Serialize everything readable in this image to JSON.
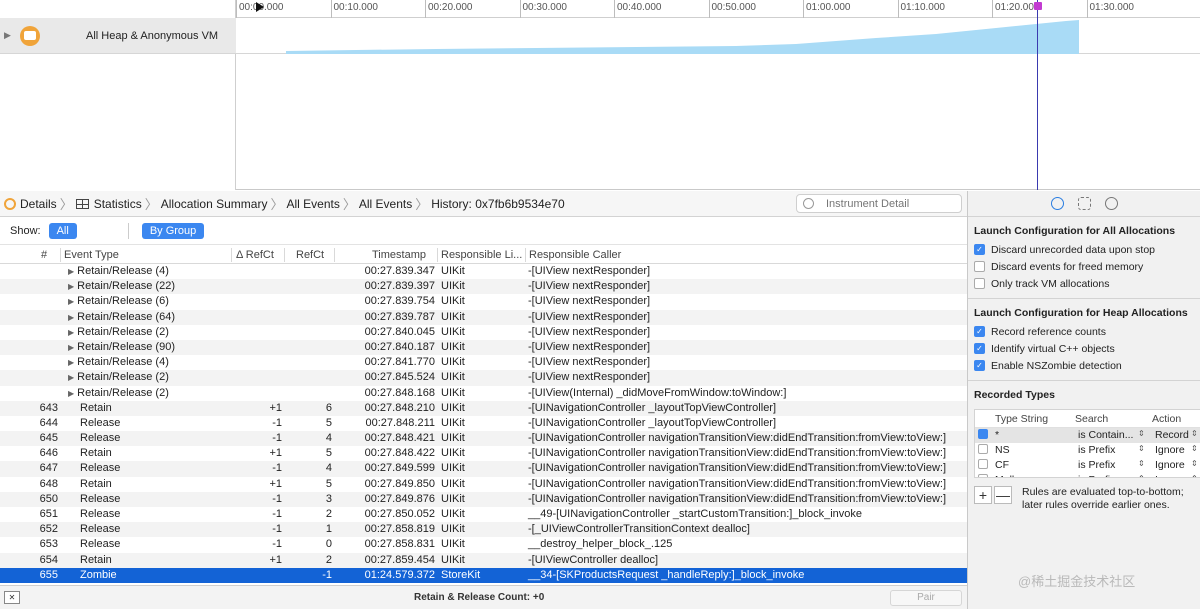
{
  "timeline": {
    "track_name": "All Heap & Anonymous VM",
    "ticks": [
      "00:00.000",
      "00:10.000",
      "00:20.000",
      "00:30.000",
      "00:40.000",
      "00:50.000",
      "01:00.000",
      "01:10.000",
      "01:20.000",
      "01:30.000"
    ]
  },
  "navbar": {
    "crumbs": [
      "Details",
      "Statistics",
      "Allocation Summary",
      "All Events",
      "All Events",
      "History: 0x7fb6b9534e70"
    ],
    "search_placeholder": "Instrument Detail"
  },
  "showbar": {
    "show_label": "Show:",
    "all_label": "All",
    "by_group_label": "By Group"
  },
  "table": {
    "columns": [
      "#",
      "Event Type",
      "Δ RefCt",
      "RefCt",
      "Timestamp",
      "Responsible Li...",
      "Responsible Caller"
    ],
    "rows": [
      {
        "num": "",
        "type": "Retain/Release (4)",
        "group": true,
        "delta": "",
        "refct": "",
        "ts": "00:27.839.347",
        "lib": "UIKit",
        "caller": "-[UIView nextResponder]"
      },
      {
        "num": "",
        "type": "Retain/Release (22)",
        "group": true,
        "delta": "",
        "refct": "",
        "ts": "00:27.839.397",
        "lib": "UIKit",
        "caller": "-[UIView nextResponder]"
      },
      {
        "num": "",
        "type": "Retain/Release (6)",
        "group": true,
        "delta": "",
        "refct": "",
        "ts": "00:27.839.754",
        "lib": "UIKit",
        "caller": "-[UIView nextResponder]"
      },
      {
        "num": "",
        "type": "Retain/Release (64)",
        "group": true,
        "delta": "",
        "refct": "",
        "ts": "00:27.839.787",
        "lib": "UIKit",
        "caller": "-[UIView nextResponder]"
      },
      {
        "num": "",
        "type": "Retain/Release (2)",
        "group": true,
        "delta": "",
        "refct": "",
        "ts": "00:27.840.045",
        "lib": "UIKit",
        "caller": "-[UIView nextResponder]"
      },
      {
        "num": "",
        "type": "Retain/Release (90)",
        "group": true,
        "delta": "",
        "refct": "",
        "ts": "00:27.840.187",
        "lib": "UIKit",
        "caller": "-[UIView nextResponder]"
      },
      {
        "num": "",
        "type": "Retain/Release (4)",
        "group": true,
        "delta": "",
        "refct": "",
        "ts": "00:27.841.770",
        "lib": "UIKit",
        "caller": "-[UIView nextResponder]"
      },
      {
        "num": "",
        "type": "Retain/Release (2)",
        "group": true,
        "delta": "",
        "refct": "",
        "ts": "00:27.845.524",
        "lib": "UIKit",
        "caller": "-[UIView nextResponder]"
      },
      {
        "num": "",
        "type": "Retain/Release (2)",
        "group": true,
        "delta": "",
        "refct": "",
        "ts": "00:27.848.168",
        "lib": "UIKit",
        "caller": "-[UIView(Internal) _didMoveFromWindow:toWindow:]"
      },
      {
        "num": "643",
        "type": "Retain",
        "group": false,
        "delta": "+1",
        "refct": "6",
        "ts": "00:27.848.210",
        "lib": "UIKit",
        "caller": "-[UINavigationController _layoutTopViewController]"
      },
      {
        "num": "644",
        "type": "Release",
        "group": false,
        "delta": "-1",
        "refct": "5",
        "ts": "00:27.848.211",
        "lib": "UIKit",
        "caller": "-[UINavigationController _layoutTopViewController]"
      },
      {
        "num": "645",
        "type": "Release",
        "group": false,
        "delta": "-1",
        "refct": "4",
        "ts": "00:27.848.421",
        "lib": "UIKit",
        "caller": "-[UINavigationController navigationTransitionView:didEndTransition:fromView:toView:]"
      },
      {
        "num": "646",
        "type": "Retain",
        "group": false,
        "delta": "+1",
        "refct": "5",
        "ts": "00:27.848.422",
        "lib": "UIKit",
        "caller": "-[UINavigationController navigationTransitionView:didEndTransition:fromView:toView:]"
      },
      {
        "num": "647",
        "type": "Release",
        "group": false,
        "delta": "-1",
        "refct": "4",
        "ts": "00:27.849.599",
        "lib": "UIKit",
        "caller": "-[UINavigationController navigationTransitionView:didEndTransition:fromView:toView:]"
      },
      {
        "num": "648",
        "type": "Retain",
        "group": false,
        "delta": "+1",
        "refct": "5",
        "ts": "00:27.849.850",
        "lib": "UIKit",
        "caller": "-[UINavigationController navigationTransitionView:didEndTransition:fromView:toView:]"
      },
      {
        "num": "650",
        "type": "Release",
        "group": false,
        "delta": "-1",
        "refct": "3",
        "ts": "00:27.849.876",
        "lib": "UIKit",
        "caller": "-[UINavigationController navigationTransitionView:didEndTransition:fromView:toView:]"
      },
      {
        "num": "651",
        "type": "Release",
        "group": false,
        "delta": "-1",
        "refct": "2",
        "ts": "00:27.850.052",
        "lib": "UIKit",
        "caller": "__49-[UINavigationController _startCustomTransition:]_block_invoke"
      },
      {
        "num": "652",
        "type": "Release",
        "group": false,
        "delta": "-1",
        "refct": "1",
        "ts": "00:27.858.819",
        "lib": "UIKit",
        "caller": "-[_UIViewControllerTransitionContext dealloc]"
      },
      {
        "num": "653",
        "type": "Release",
        "group": false,
        "delta": "-1",
        "refct": "0",
        "ts": "00:27.858.831",
        "lib": "UIKit",
        "caller": "__destroy_helper_block_.125"
      },
      {
        "num": "654",
        "type": "Retain",
        "group": false,
        "delta": "+1",
        "refct": "2",
        "ts": "00:27.859.454",
        "lib": "UIKit",
        "caller": "-[UIViewController dealloc]"
      },
      {
        "num": "655",
        "type": "Zombie",
        "group": false,
        "delta": "",
        "refct": "-1",
        "ts": "01:24.579.372",
        "lib": "StoreKit",
        "caller": "__34-[SKProductsRequest _handleReply:]_block_invoke",
        "selected": true
      }
    ]
  },
  "bottombar": {
    "status": "Retain & Release Count: +0",
    "pair_button": "Pair"
  },
  "inspector": {
    "launch_all_title": "Launch Configuration for All Allocations",
    "launch_all_options": [
      {
        "label": "Discard unrecorded data upon stop",
        "checked": true
      },
      {
        "label": "Discard events for freed memory",
        "checked": false
      },
      {
        "label": "Only track VM allocations",
        "checked": false
      }
    ],
    "launch_heap_title": "Launch Configuration for Heap Allocations",
    "launch_heap_options": [
      {
        "label": "Record reference counts",
        "checked": true
      },
      {
        "label": "Identify virtual C++ objects",
        "checked": true
      },
      {
        "label": "Enable NSZombie detection",
        "checked": true
      }
    ],
    "recorded_types_title": "Recorded Types",
    "types_columns": [
      "Type String",
      "Search",
      "Action"
    ],
    "types_rows": [
      {
        "checked": true,
        "type": "*",
        "search": "is Contain...",
        "action": "Record"
      },
      {
        "checked": false,
        "type": "NS",
        "search": "is Prefix",
        "action": "Ignore"
      },
      {
        "checked": false,
        "type": "CF",
        "search": "is Prefix",
        "action": "Ignore"
      },
      {
        "checked": false,
        "type": "Malloc",
        "search": "is Prefix",
        "action": "Ignore"
      }
    ],
    "add_label": "+",
    "remove_label": "—",
    "rules_note_1": "Rules are evaluated top-to-bottom;",
    "rules_note_2": "later rules override earlier ones."
  },
  "watermark": "@稀土掘金技术社区",
  "colors": {
    "accent": "#3b87f0",
    "selection": "#1363d6",
    "graph_fill": "#a9dbf6",
    "instrument": "#f0a43a",
    "playhead": "#3a3ab0"
  }
}
